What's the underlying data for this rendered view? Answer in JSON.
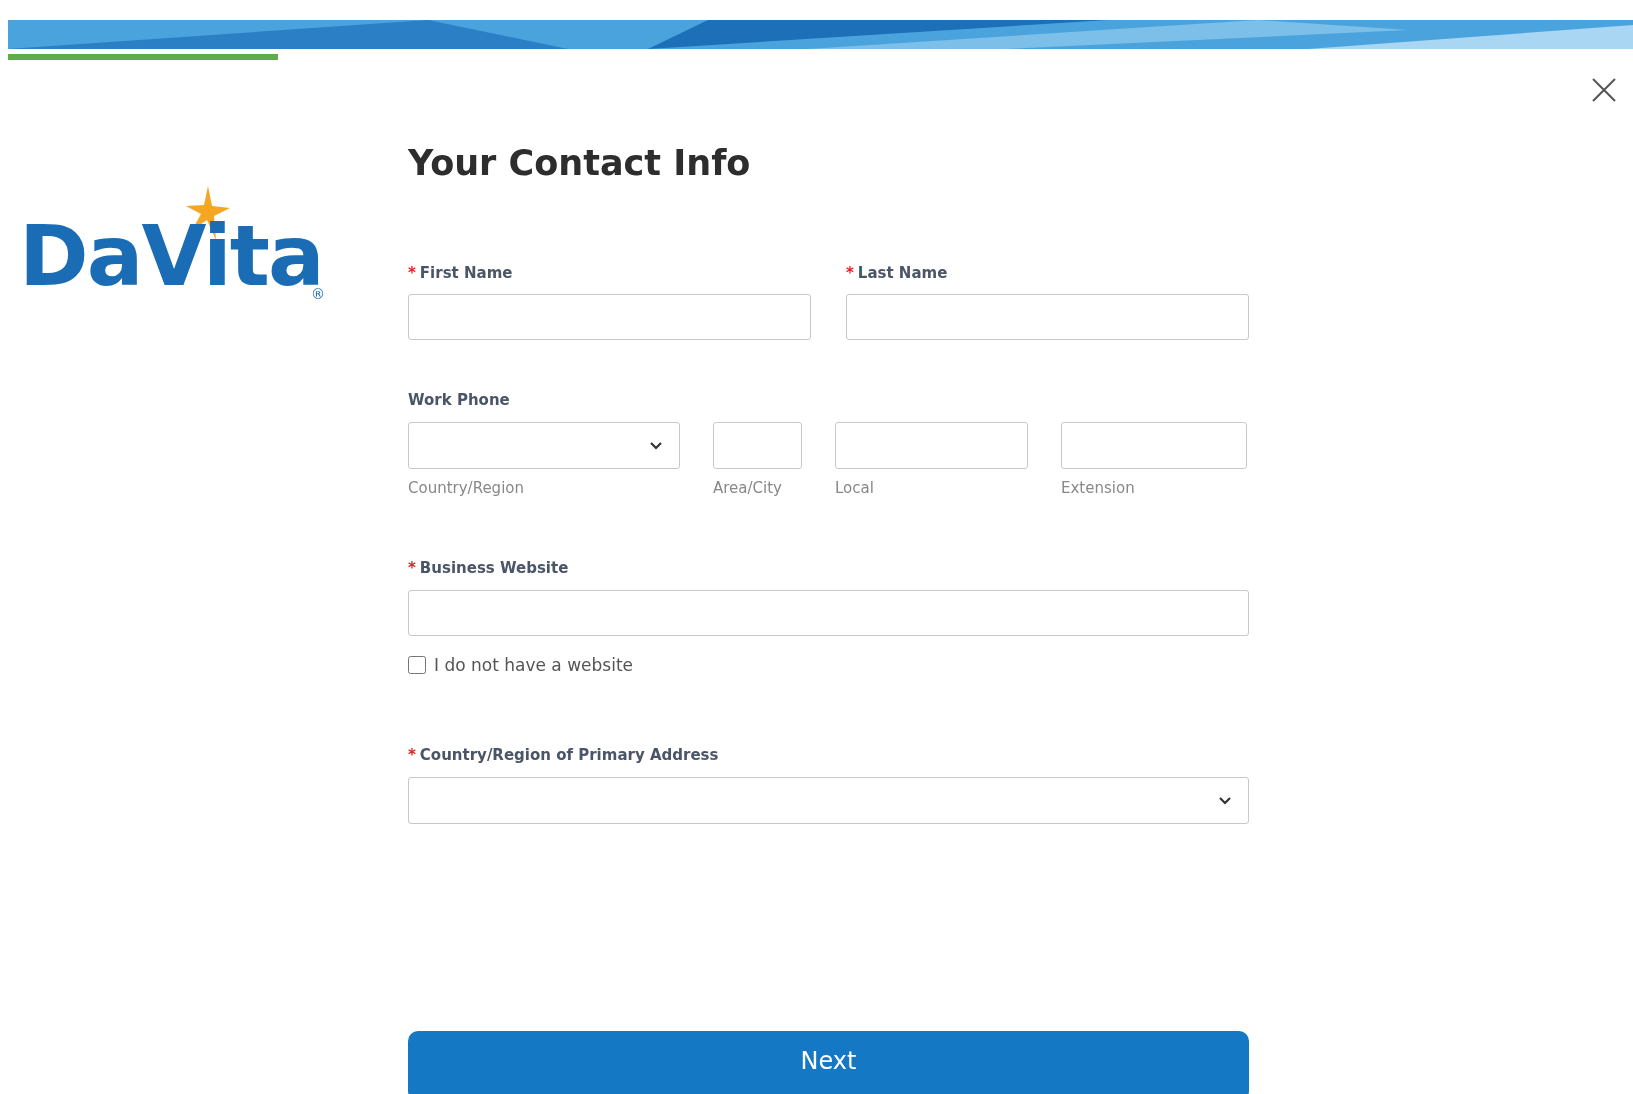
{
  "logo": {
    "text": "DaVita",
    "mark": "®"
  },
  "title": "Your Contact Info",
  "name_fields": [
    {
      "label": "First Name",
      "required_mark": "*"
    },
    {
      "label": "Last Name",
      "required_mark": "*"
    }
  ],
  "work_phone": {
    "label": "Work Phone",
    "parts": [
      {
        "kind": "select",
        "caption": "Country/Region"
      },
      {
        "kind": "input",
        "caption": "Area/City"
      },
      {
        "kind": "input",
        "caption": "Local"
      },
      {
        "kind": "input",
        "caption": "Extension"
      }
    ]
  },
  "business_website": {
    "label": "Business Website",
    "required_mark": "*",
    "checkbox": {
      "label": "I do not have a website",
      "checked": false
    }
  },
  "country": {
    "label": "Country/Region of Primary Address",
    "required_mark": "*"
  },
  "next_button": "Next"
}
